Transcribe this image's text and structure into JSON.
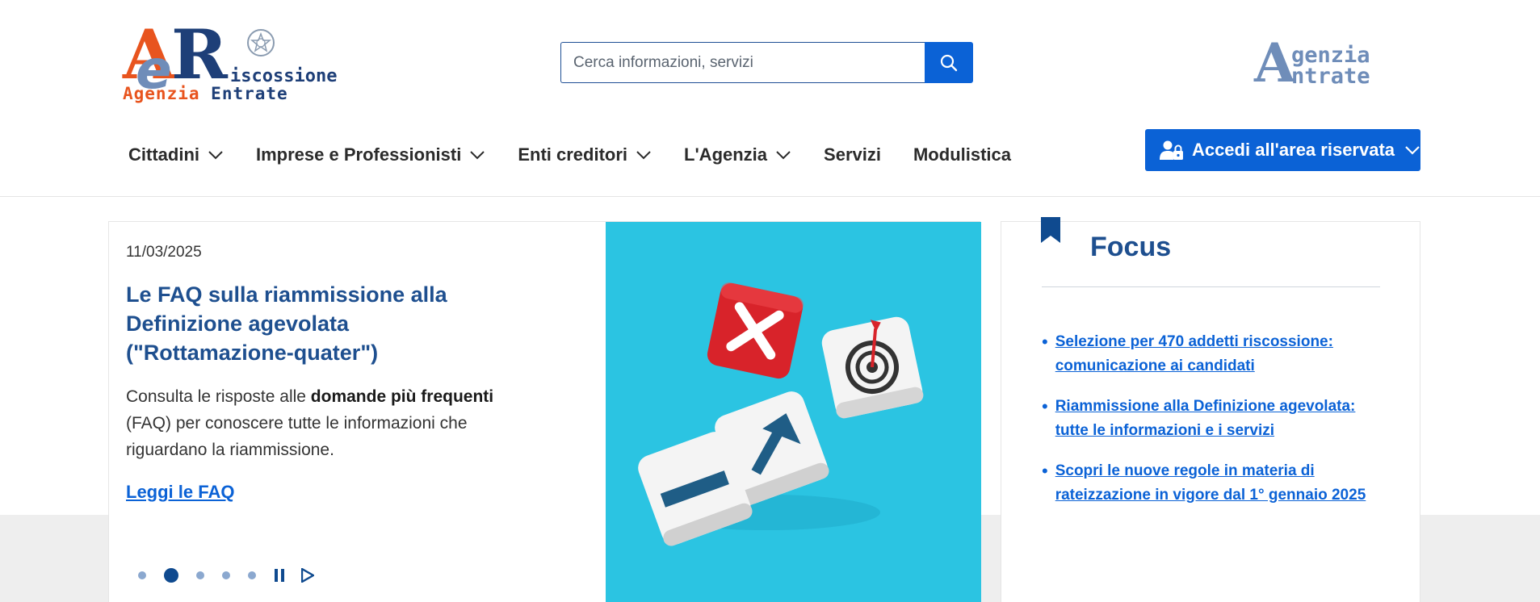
{
  "header": {
    "logo": {
      "mark_left": "A",
      "mark_middle": "e",
      "mark_right": "R",
      "word_top": "iscossione",
      "word_bottom_1": "Agenzia",
      "word_bottom_2": "Entrate"
    },
    "search": {
      "placeholder": "Cerca informazioni, servizi"
    },
    "partner_logo": {
      "mark": "A",
      "line1": "genzia",
      "line2": "ntrate"
    }
  },
  "nav": {
    "items": [
      {
        "label": "Cittadini",
        "has_menu": true
      },
      {
        "label": "Imprese e Professionisti",
        "has_menu": true
      },
      {
        "label": "Enti creditori",
        "has_menu": true
      },
      {
        "label": "L'Agenzia",
        "has_menu": true
      },
      {
        "label": "Servizi",
        "has_menu": false
      },
      {
        "label": "Modulistica",
        "has_menu": false
      }
    ],
    "access_button": "Accedi all'area riservata"
  },
  "carousel": {
    "date": "11/03/2025",
    "title": "Le FAQ sulla riammissione alla Definizione agevolata (\"Rottamazione-quater\")",
    "desc_prefix": "Consulta le risposte alle ",
    "desc_bold": "domande più frequenti",
    "desc_suffix": " (FAQ) per conoscere tutte le informazioni che riguardano la riammissione.",
    "link": "Leggi le FAQ",
    "slides": 5,
    "active_slide": 2
  },
  "focus": {
    "title": "Focus",
    "links": [
      "Selezione per 470 addetti riscossione: comunicazione ai candidati",
      "Riammissione alla Definizione agevolata: tutte le informazioni e i servizi",
      "Scopri le nuove regole in materia di rateizzazione in vigore dal 1° gennaio 2025"
    ]
  },
  "colors": {
    "primary": "#0b62d6",
    "title_blue": "#1e4f8f",
    "logo_orange": "#e8541e",
    "logo_navy": "#1e3f78",
    "photo_bg": "#2bc4e2"
  }
}
